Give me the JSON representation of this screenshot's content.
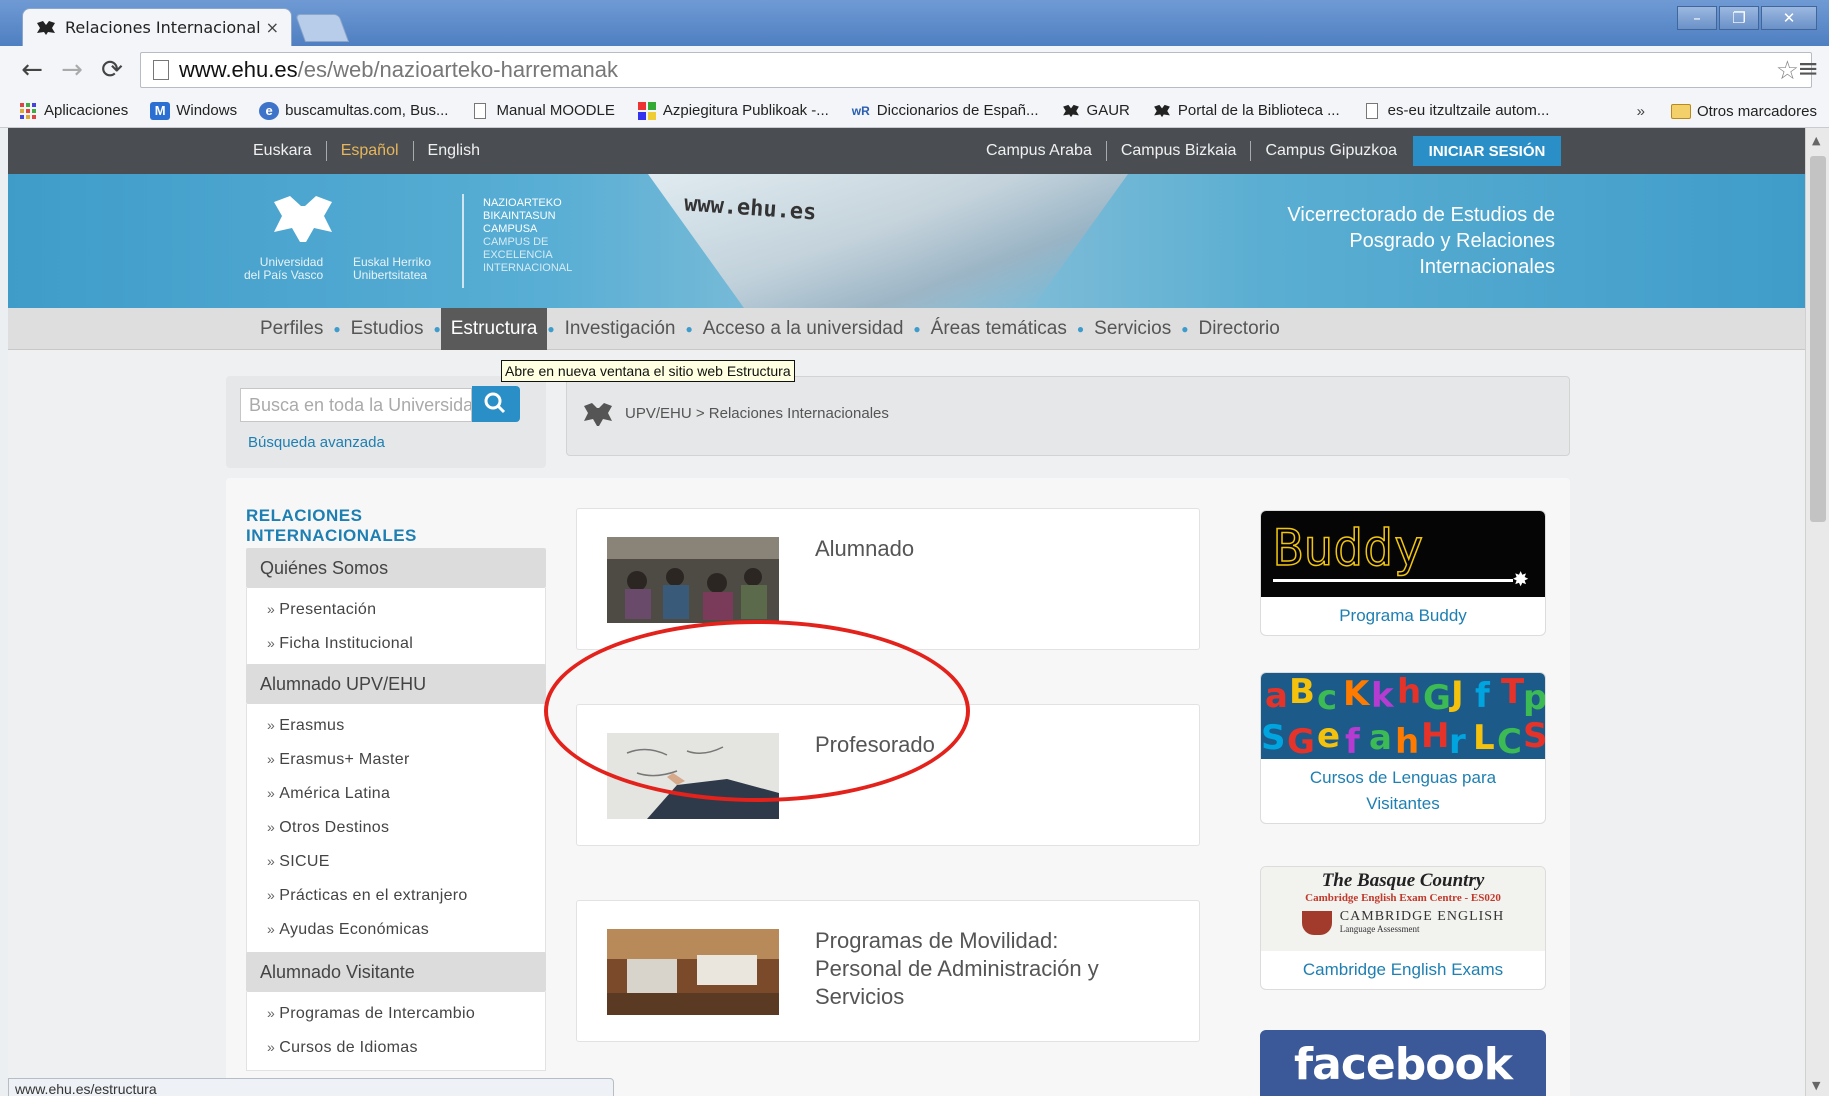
{
  "browser": {
    "tab_title": "Relaciones Internacionales -",
    "tab_close": "×",
    "url_host": "www.ehu.es",
    "url_path": "/es/web/nazioarteko-harremanak",
    "bookmarks": [
      {
        "label": "Aplicaciones",
        "icon": "apps-grid-icon"
      },
      {
        "label": "Windows",
        "icon": "windows-live-icon"
      },
      {
        "label": "buscamultas.com, Bus...",
        "icon": "globe-icon"
      },
      {
        "label": "Manual MOODLE",
        "icon": "page-icon"
      },
      {
        "label": "Azpiegitura Publikoak -...",
        "icon": "puzzle-icon"
      },
      {
        "label": "Diccionarios de Españ...",
        "icon": "wr-icon"
      },
      {
        "label": "GAUR",
        "icon": "ehu-icon"
      },
      {
        "label": "Portal de la Biblioteca ...",
        "icon": "ehu-icon"
      },
      {
        "label": "es-eu itzultzaile autom...",
        "icon": "page-icon"
      }
    ],
    "bookmarks_more": "»",
    "other_bookmarks": "Otros marcadores",
    "status_url": "www.ehu.es/estructura"
  },
  "topbar": {
    "languages": [
      "Euskara",
      "Español",
      "English"
    ],
    "active_language": "Español",
    "campuses": [
      "Campus Araba",
      "Campus Bizkaia",
      "Campus Gipuzkoa"
    ],
    "login": "INICIAR SESIÓN"
  },
  "banner": {
    "uni_es": [
      "Universidad",
      "del País Vasco"
    ],
    "uni_eu": [
      "Euskal Herriko",
      "Unibertsitatea"
    ],
    "campus_lines": [
      "NAZIOARTEKO",
      "BIKAINTASUN",
      "CAMPUSA",
      "CAMPUS DE",
      "EXCELENCIA",
      "INTERNACIONAL"
    ],
    "paper_text": "www.ehu.es",
    "vicerrectorado": [
      "Vicerrectorado de Estudios de",
      "Posgrado y Relaciones",
      "Internacionales"
    ]
  },
  "mainnav": {
    "items": [
      "Perfiles",
      "Estudios",
      "Estructura",
      "Investigación",
      "Acceso a la universidad",
      "Áreas temáticas",
      "Servicios",
      "Directorio"
    ],
    "active": "Estructura",
    "tooltip": "Abre en nueva ventana el sitio web Estructura"
  },
  "search": {
    "placeholder": "Busca en toda la Universidad",
    "advanced": "Búsqueda avanzada"
  },
  "breadcrumb": "UPV/EHU > Relaciones Internacionales",
  "sidebar": {
    "title": [
      "RELACIONES",
      "INTERNACIONALES"
    ],
    "groups": [
      {
        "head": "Quiénes Somos",
        "links": [
          "Presentación",
          "Ficha Institucional"
        ]
      },
      {
        "head": "Alumnado UPV/EHU",
        "links": [
          "Erasmus",
          "Erasmus+ Master",
          "América Latina",
          "Otros Destinos",
          "SICUE",
          "Prácticas en el extranjero",
          "Ayudas Económicas"
        ]
      },
      {
        "head": "Alumnado Visitante",
        "links": [
          "Programas de Intercambio",
          "Cursos de Idiomas"
        ]
      }
    ]
  },
  "cards": [
    {
      "title": "Alumnado"
    },
    {
      "title": "Profesorado"
    },
    {
      "title_lines": [
        "Programas de Movilidad:",
        "Personal de Administración y",
        "Servicios"
      ]
    }
  ],
  "promos": {
    "buddy_logo": "Buddy",
    "buddy_caption": "Programa Buddy",
    "lenguas_caption": [
      "Cursos de Lenguas para",
      "Visitantes"
    ],
    "cambridge_head": "The Basque Country",
    "cambridge_sub": "Cambridge English Exam Centre - ES020",
    "cambridge_brand": "CAMBRIDGE ENGLISH",
    "cambridge_brand_sub": "Language Assessment",
    "cambridge_caption": "Cambridge English Exams",
    "facebook_logo": "facebook"
  },
  "colors": {
    "accent_blue": "#2a8fc6",
    "link_blue": "#1e7fb2",
    "annotation_red": "#e3221c",
    "topbar": "#4a4e52"
  }
}
